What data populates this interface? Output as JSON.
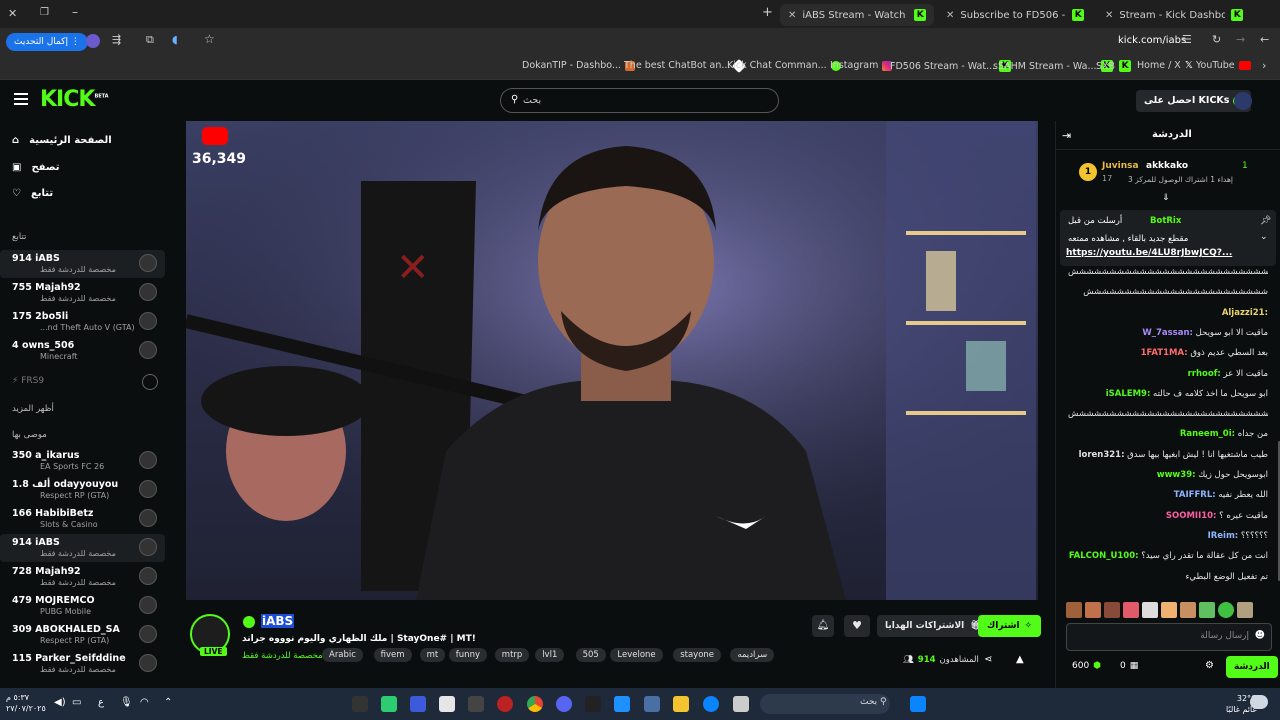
{
  "browser": {
    "tabs": [
      {
        "title": "iABS Stream - Watch Live on Ki",
        "active": true
      },
      {
        "title": "Subscribe to FD506 - Kick Strea",
        "active": false
      },
      {
        "title": "Stream - Kick Dashboard",
        "active": false
      }
    ],
    "update_button": "إكمال التحديث",
    "url": "kick.com/iabs",
    "bookmarks": [
      "DokanTIP - Dashbo...",
      "The best ChatBot an...",
      "Kick Chat Comman...",
      "Instagram",
      "FD506 Stream - Wat...",
      "sSAHM Stream - Wa...",
      "SXB",
      "Home / X",
      "YouTube"
    ]
  },
  "kick": {
    "logo": "KICK",
    "logo_badge": "BETA",
    "search_placeholder": "بحث",
    "get_kicks": "احصل على KICKs"
  },
  "sidebar": {
    "nav": [
      {
        "label": "الصفحة الرئيسية",
        "icon": "home-icon"
      },
      {
        "label": "تصفح",
        "icon": "browse-icon"
      },
      {
        "label": "تتابع",
        "icon": "heart-icon"
      }
    ],
    "following_title": "تتابع",
    "following": [
      {
        "viewers": "914",
        "name": "iABS",
        "sub": "مخصصة للدردشة فقط",
        "selected": true
      },
      {
        "viewers": "755",
        "name": "Majah92",
        "sub": "مخصصة للدردشة فقط",
        "selected": false
      },
      {
        "viewers": "175",
        "name": "2bo5li",
        "sub": "...nd Theft Auto V (GTA)",
        "selected": false
      },
      {
        "viewers": "4",
        "name": "owns_506",
        "sub": "Minecraft",
        "selected": false
      }
    ],
    "offline": "FRS9",
    "show_more": "أظهر المزيد",
    "recommended_title": "موصى بها",
    "recommended": [
      {
        "viewers": "350",
        "name": "a_ikarus",
        "sub": "EA Sports FC 26",
        "selected": false
      },
      {
        "viewers": "1.8 ألف",
        "name": "odayyouyou",
        "sub": "Respect RP (GTA)",
        "selected": false
      },
      {
        "viewers": "166",
        "name": "HabibiBetz",
        "sub": "Slots & Casino",
        "selected": false
      },
      {
        "viewers": "914",
        "name": "iABS",
        "sub": "مخصصة للدردشة فقط",
        "selected": true
      },
      {
        "viewers": "728",
        "name": "Majah92",
        "sub": "مخصصة للدردشة فقط",
        "selected": false
      },
      {
        "viewers": "479",
        "name": "MOJREMCO",
        "sub": "PUBG Mobile",
        "selected": false
      },
      {
        "viewers": "309",
        "name": "ABOKHALED_SA",
        "sub": "Respect RP (GTA)",
        "selected": false
      },
      {
        "viewers": "115",
        "name": "Parker_Seifddine",
        "sub": "مخصصة للدردشة فقط",
        "selected": false
      }
    ]
  },
  "video": {
    "viewer_overlay": "36,349"
  },
  "stream": {
    "channel": "iABS",
    "live": "LIVE",
    "title": "ملك الظهاري واليوم نوووه جراند | StayOne# | MT!",
    "category": "مخصصة للدردشة فقط",
    "tags": [
      "Arabic",
      "fivem",
      "mt",
      "funny",
      "mtrp",
      "lvl1",
      "505",
      "Levelone",
      "stayone",
      "سراديمه"
    ],
    "subscribe_button": "اشتراك",
    "gift_button": "الاشتراكات الهدايا",
    "viewers_label": "المشاهدون",
    "viewers_count": "914"
  },
  "chat": {
    "title": "الدردشة",
    "leaderboard": [
      {
        "rank": "1",
        "name": "Juvinsa",
        "count": "17"
      },
      {
        "name": "akkkako",
        "count": "1",
        "sub": "إهداء 1 اشتراك الوصول للمركز 3"
      }
    ],
    "pinned": {
      "sender": "BotRix",
      "label": "أرسلت من قبل",
      "text": "مقطع جديد بالقاء , مشاهده ممتعه",
      "link": "https://youtu.be/4LU8rJbwJCQ?..."
    },
    "messages": [
      {
        "user": "",
        "text": "شششششششششششششششششششششششششششششششششش",
        "color": "#e0e0e0"
      },
      {
        "user": "",
        "text": "شششششششششششششششششششششششش",
        "color": "#e0e0e0"
      },
      {
        "user": "Aljazzi21:",
        "text": "",
        "color": "#e9d16b"
      },
      {
        "user": "W_7assan:",
        "text": "ماقيت الا ابو سويحل",
        "color": "#a98bf6"
      },
      {
        "user": "1FAT1MA:",
        "text": "بعد السطي عديم ذوق",
        "color": "#ff6b6b"
      },
      {
        "user": "rrhoof:",
        "text": "ماقيت الا عز",
        "color": "#53fc18"
      },
      {
        "user": "iSALEM9:",
        "text": "ابو سويحل ما أخذ كلامه ف حالته",
        "color": "#53fc18"
      },
      {
        "user": "",
        "text": "شششششششششششششششششششششششششششششششششش",
        "color": "#e0e0e0"
      },
      {
        "user": "Raneem_0i:",
        "text": "من جداه",
        "color": "#53fc18"
      },
      {
        "user": "loren321:",
        "text": "طيب ماشتغيها انا ! ليش ابغيها بيها سدق",
        "color": "#e0e0e0"
      },
      {
        "user": "www39:",
        "text": "ابوسويحل حول زيك",
        "color": "#53fc18"
      },
      {
        "user": "TAIFFRL:",
        "text": "الله يعطر نفيه",
        "color": "#8fb4ff"
      },
      {
        "user": "SOOMII10:",
        "text": "ماقيت عيره ؟",
        "color": "#ff5fa2"
      },
      {
        "user": "IReim:",
        "text": "؟؟؟؟؟؟",
        "color": "#8fb4ff"
      },
      {
        "user": "FALCON_U100:",
        "text": "انت من كل عقالة ما تقدر راي سيد؟",
        "color": "#53fc18"
      },
      {
        "user": "",
        "text": "تم تفعيل الوضع البطيء",
        "color": "#a0a0a0"
      }
    ],
    "input_placeholder": "إرسال رسالة",
    "points": "600",
    "gift_count": "0",
    "chat_button": "الدردشة"
  },
  "taskbar": {
    "search": "بحث",
    "weather_temp": "32°C",
    "weather_text": "غائم غالبًا",
    "time": "٥:٣٧ م",
    "date": "٢٧/٠٧/٢٠٢٥"
  }
}
